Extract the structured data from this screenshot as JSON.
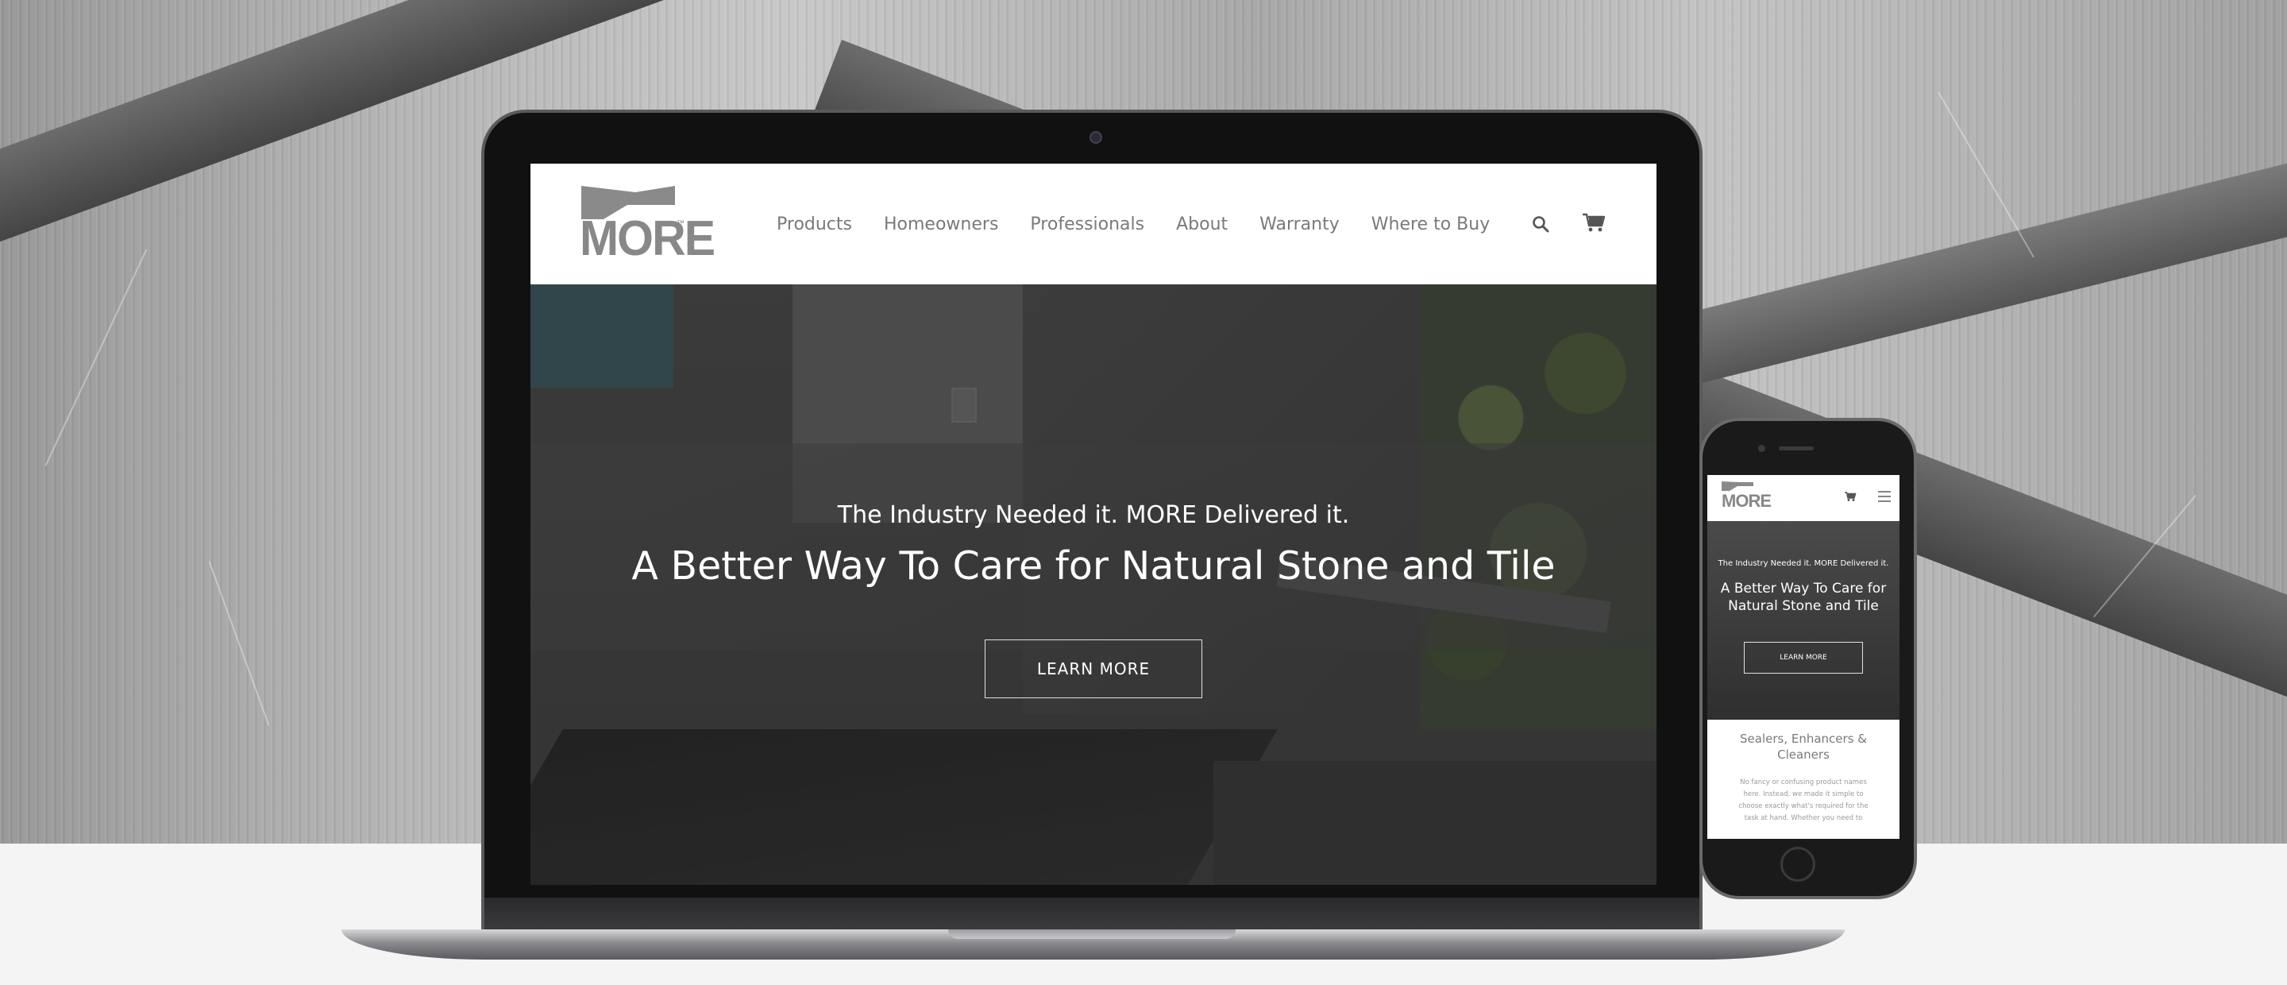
{
  "site": {
    "logo_text": "MORE",
    "logo_tm": "™",
    "nav": [
      "Products",
      "Homeowners",
      "Professionals",
      "About",
      "Warranty",
      "Where to Buy"
    ],
    "icons": {
      "search": "search-icon",
      "cart": "cart-icon",
      "menu": "hamburger-menu-icon"
    }
  },
  "hero": {
    "subtitle": "The Industry Needed it. MORE Delivered it.",
    "title": "A Better Way To Care for Natural Stone and Tile",
    "button": "LEARN MORE"
  },
  "mobile": {
    "hero_subtitle": "The Industry Needed it. MORE Delivered it.",
    "hero_title": "A Better Way To Care for Natural Stone and Tile",
    "hero_button": "LEARN MORE",
    "section_title": "Sealers, Enhancers & Cleaners",
    "section_body": "No fancy or confusing product names here. Instead, we made it simple to choose exactly what's required for the task at hand. Whether you need to"
  },
  "colors": {
    "nav_text": "#7a7a7a",
    "logo": "#888888",
    "hero_text": "#ffffff",
    "floor": "#f4f4f4"
  }
}
